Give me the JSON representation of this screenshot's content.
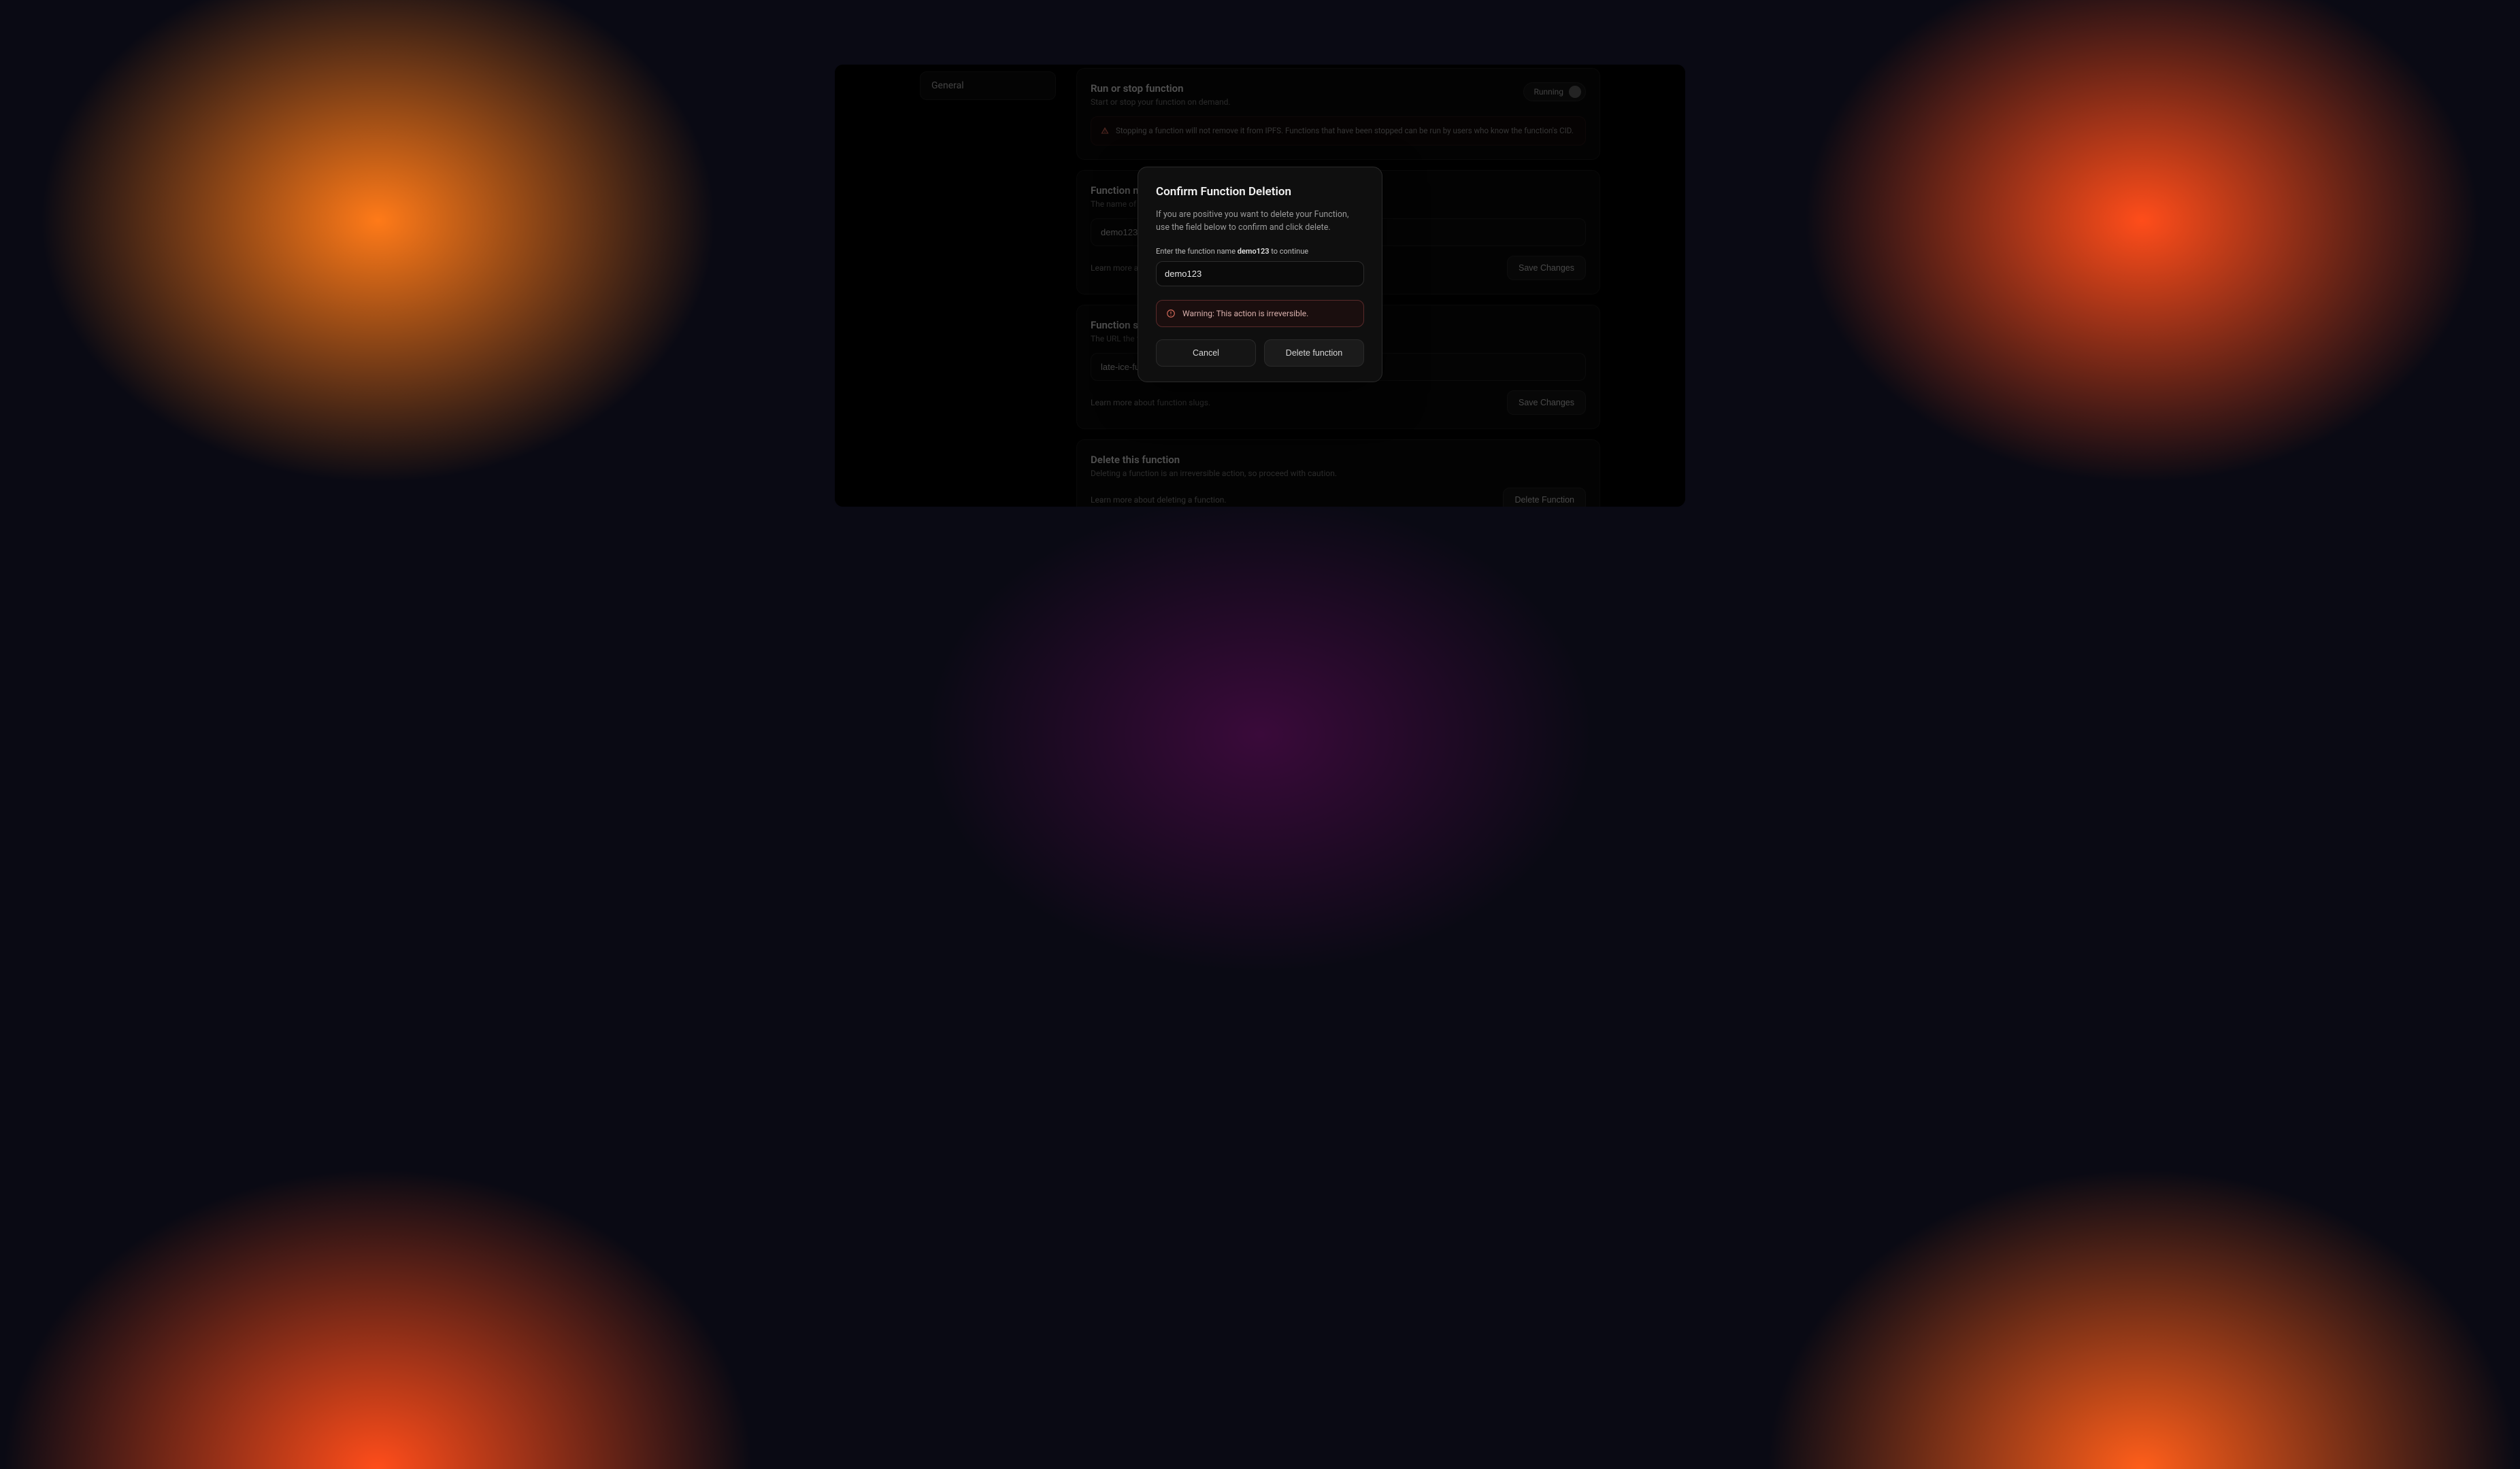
{
  "sidebar": {
    "items": [
      {
        "label": "General"
      }
    ]
  },
  "sections": {
    "run": {
      "title": "Run or stop function",
      "subtitle": "Start or stop your function on demand.",
      "toggle_label": "Running",
      "alert": "Stopping a function will not remove it from IPFS. Functions that have been stopped can be run by users who know the function's CID."
    },
    "name": {
      "title": "Function name",
      "subtitle": "The name of your function.",
      "value": "demo123",
      "learn_more": "Learn more about function names.",
      "save_label": "Save Changes"
    },
    "slug": {
      "title": "Function slug",
      "subtitle": "The URL the function is accessible at.",
      "value": "late-ice-full",
      "learn_more": "Learn more about function slugs.",
      "save_label": "Save Changes"
    },
    "delete": {
      "title": "Delete this function",
      "subtitle": "Deleting a function is an irreversible action, so proceed with caution.",
      "learn_more": "Learn more about deleting a function.",
      "button_label": "Delete Function"
    }
  },
  "modal": {
    "title": "Confirm Function Deletion",
    "description": "If you are positive you want to delete your Function, use the field below to confirm and click delete.",
    "label_prefix": "Enter the function name",
    "label_name": "demo123",
    "label_suffix": "to continue",
    "input_value": "demo123",
    "warning": "Warning: This action is irreversible.",
    "cancel_label": "Cancel",
    "confirm_label": "Delete function"
  }
}
